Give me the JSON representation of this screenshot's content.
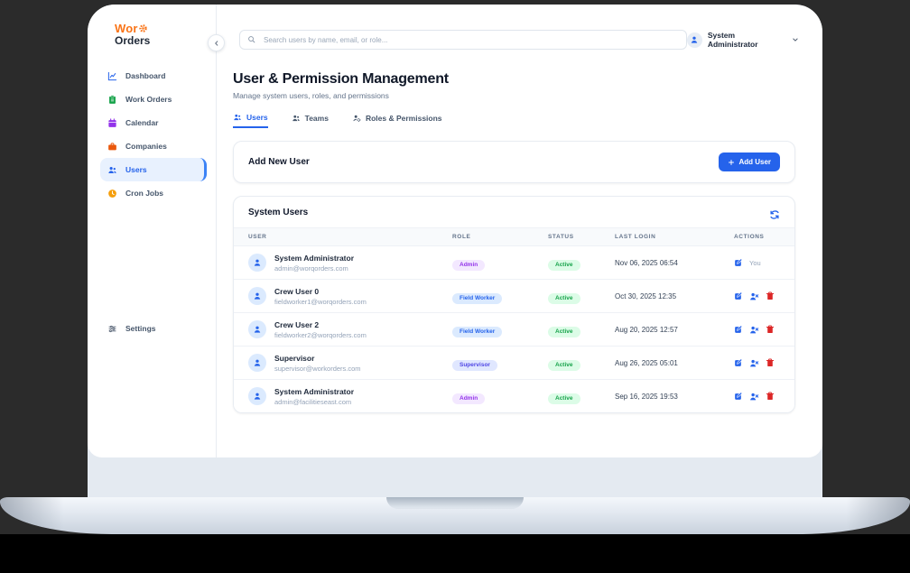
{
  "brand": {
    "name_top": "Wor",
    "name_bottom": "Orders"
  },
  "topbar": {
    "search_placeholder": "Search users by name, email, or role...",
    "user_menu_label": "System Administrator"
  },
  "sidebar": {
    "items": [
      {
        "label": "Dashboard",
        "icon": "chart-icon",
        "active": false
      },
      {
        "label": "Work Orders",
        "icon": "clipboard-icon",
        "active": false
      },
      {
        "label": "Calendar",
        "icon": "calendar-icon",
        "active": false
      },
      {
        "label": "Companies",
        "icon": "briefcase-icon",
        "active": false
      },
      {
        "label": "Users",
        "icon": "users-icon",
        "active": true
      },
      {
        "label": "Cron Jobs",
        "icon": "clock-icon",
        "active": false
      }
    ],
    "settings_label": "Settings"
  },
  "page": {
    "title": "User & Permission Management",
    "subtitle": "Manage system users, roles, and permissions"
  },
  "tabs": [
    {
      "label": "Users",
      "active": true
    },
    {
      "label": "Teams",
      "active": false
    },
    {
      "label": "Roles & Permissions",
      "active": false
    }
  ],
  "add_user_card": {
    "title": "Add New User",
    "button_label": "Add User"
  },
  "users_card": {
    "title": "System Users",
    "columns": [
      "USER",
      "ROLE",
      "STATUS",
      "LAST LOGIN",
      "ACTIONS"
    ],
    "you_label": "You",
    "users": [
      {
        "name": "System Administrator",
        "email": "admin@worqorders.com",
        "role": "Admin",
        "role_variant": "admin",
        "status": "Active",
        "last_login": "Nov 06, 2025 06:54",
        "is_current": true
      },
      {
        "name": "Crew User 0",
        "email": "fieldworker1@worqorders.com",
        "role": "Field Worker",
        "role_variant": "field",
        "status": "Active",
        "last_login": "Oct 30, 2025 12:35",
        "is_current": false
      },
      {
        "name": "Crew User 2",
        "email": "fieldworker2@worqorders.com",
        "role": "Field Worker",
        "role_variant": "field",
        "status": "Active",
        "last_login": "Aug 20, 2025 12:57",
        "is_current": false
      },
      {
        "name": "Supervisor",
        "email": "supervisor@workorders.com",
        "role": "Supervisor",
        "role_variant": "supervisor",
        "status": "Active",
        "last_login": "Aug 26, 2025 05:01",
        "is_current": false
      },
      {
        "name": "System Administrator",
        "email": "admin@facilitieseast.com",
        "role": "Admin",
        "role_variant": "admin",
        "status": "Active",
        "last_login": "Sep 16, 2025 19:53",
        "is_current": false
      }
    ]
  },
  "colors": {
    "accent": "#2563eb",
    "logo_orange": "#f97316",
    "danger": "#dc2626",
    "admin_badge_bg": "#f3e8ff",
    "admin_badge_text": "#9333ea",
    "field_badge_bg": "#dbeafe",
    "field_badge_text": "#2563eb",
    "supervisor_badge_bg": "#e0e7ff",
    "supervisor_badge_text": "#4f46e5",
    "active_badge_bg": "#dcfce7",
    "active_badge_text": "#16a34a"
  }
}
